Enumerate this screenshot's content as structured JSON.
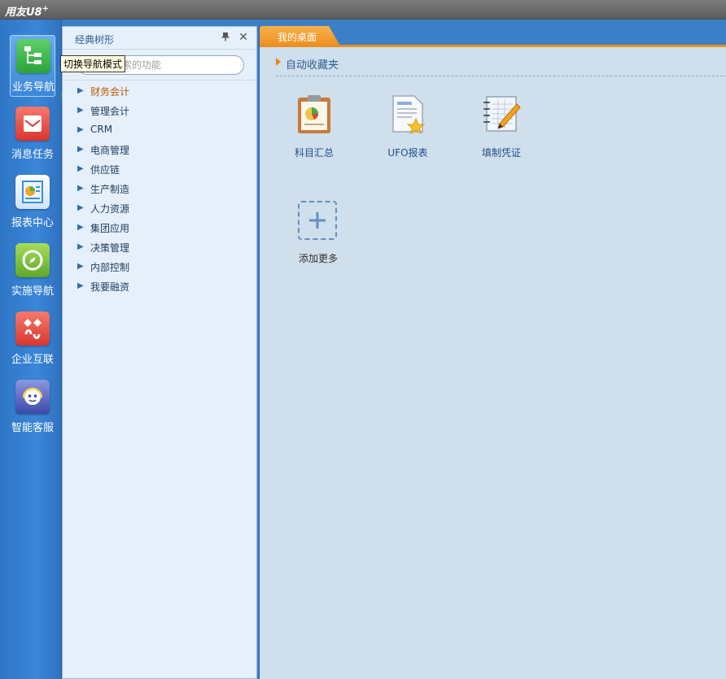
{
  "app": {
    "title": "用友U8",
    "title_sup": "+"
  },
  "nav": [
    {
      "label": "业务导航",
      "icon": "business-nav-icon",
      "color": "#3bb54a",
      "active": true
    },
    {
      "label": "消息任务",
      "icon": "message-task-icon",
      "color": "#e8453c"
    },
    {
      "label": "报表中心",
      "icon": "report-center-icon",
      "color": "#3a8fde"
    },
    {
      "label": "实施导航",
      "icon": "compass-icon",
      "color": "#7cc23a"
    },
    {
      "label": "企业互联",
      "icon": "enterprise-link-icon",
      "color": "#e8453c"
    },
    {
      "label": "智能客服",
      "icon": "smart-service-icon",
      "color": "#5a6fc9"
    }
  ],
  "tooltip": "切换导航模式",
  "tree": {
    "title": "经典树形",
    "search_placeholder": "您要搜索的功能",
    "items": [
      "财务会计",
      "管理会计",
      "CRM",
      "电商管理",
      "供应链",
      "生产制造",
      "人力资源",
      "集团应用",
      "决策管理",
      "内部控制",
      "我要融资"
    ]
  },
  "main": {
    "tab": "我的桌面",
    "favorites_label": "自动收藏夹",
    "shortcuts": [
      {
        "label": "科目汇总",
        "icon": "clipboard-chart-icon"
      },
      {
        "label": "UFO报表",
        "icon": "report-star-icon"
      },
      {
        "label": "填制凭证",
        "icon": "notebook-pencil-icon"
      }
    ],
    "add_more": "添加更多"
  },
  "colors": {
    "accent": "#ee8f1a",
    "nav_bg": "#3c7fc9",
    "desktop_bg": "#d0dfec"
  }
}
